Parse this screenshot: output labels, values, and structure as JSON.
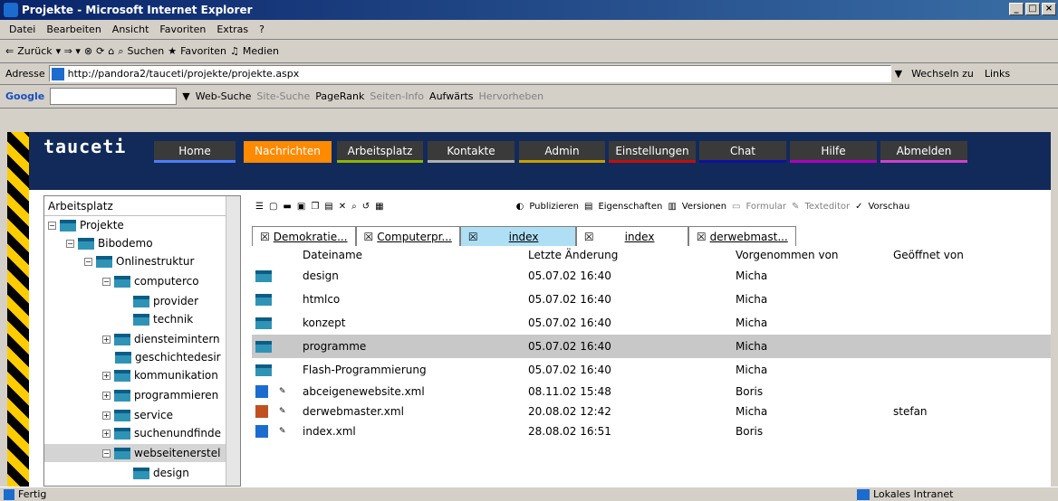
{
  "window": {
    "title": "Projekte - Microsoft Internet Explorer"
  },
  "menu": [
    "Datei",
    "Bearbeiten",
    "Ansicht",
    "Favoriten",
    "Extras",
    "?"
  ],
  "toolbar": {
    "back": "Zurück",
    "search": "Suchen",
    "favorites": "Favoriten",
    "media": "Medien"
  },
  "address": {
    "label": "Adresse",
    "url": "http://pandora2/tauceti/projekte/projekte.aspx",
    "go": "Wechseln zu",
    "links": "Links"
  },
  "google": {
    "label": "Google",
    "web_search": "Web-Suche",
    "site_search": "Site-Suche",
    "pagerank": "PageRank",
    "page_info": "Seiten-Info",
    "up": "Aufwärts",
    "highlight": "Hervorheben"
  },
  "app": {
    "logo": "tauceti",
    "nav": [
      {
        "label": "Home",
        "color": "#4d7cff"
      },
      {
        "label": "Nachrichten",
        "color": "#ff8a00"
      },
      {
        "label": "Arbeitsplatz",
        "color": "#8db600"
      },
      {
        "label": "Kontakte",
        "color": "#b0b0b0"
      },
      {
        "label": "Admin",
        "color": "#c8a000"
      },
      {
        "label": "Einstellungen",
        "color": "#c01010"
      },
      {
        "label": "Chat",
        "color": "#1010a0"
      },
      {
        "label": "Hilfe",
        "color": "#b000c0"
      },
      {
        "label": "Abmelden",
        "color": "#d040d0"
      }
    ]
  },
  "sidebar": {
    "title": "Arbeitsplatz",
    "items": [
      {
        "label": "Projekte",
        "expander": "−"
      },
      {
        "label": "Bibodemo",
        "expander": "−"
      },
      {
        "label": "Onlinestruktur",
        "expander": "−"
      },
      {
        "label": "computerco",
        "expander": "−"
      },
      {
        "label": "provider",
        "expander": ""
      },
      {
        "label": "technik",
        "expander": ""
      },
      {
        "label": "diensteimintern",
        "expander": "+"
      },
      {
        "label": "geschichtedesir",
        "expander": ""
      },
      {
        "label": "kommunikation",
        "expander": "+"
      },
      {
        "label": "programmieren",
        "expander": "+"
      },
      {
        "label": "service",
        "expander": "+"
      },
      {
        "label": "suchenundfinde",
        "expander": "+"
      },
      {
        "label": "webseitenerstel",
        "expander": "−"
      },
      {
        "label": "design",
        "expander": ""
      }
    ]
  },
  "main": {
    "toolbar": {
      "publish": "Publizieren",
      "properties": "Eigenschaften",
      "versions": "Versionen",
      "form": "Formular",
      "texteditor": "Texteditor",
      "preview": "Vorschau"
    },
    "tabs": [
      "Demokratie...",
      "Computerpr...",
      "index",
      "index",
      "derwebmast..."
    ],
    "columns": [
      "Dateiname",
      "Letzte Änderung",
      "Vorgenommen von",
      "Geöffnet von"
    ],
    "rows": [
      {
        "name": "design",
        "date": "05.07.02 16:40",
        "by": "Micha",
        "open": "",
        "type": "folder"
      },
      {
        "name": "htmlco",
        "date": "05.07.02 16:40",
        "by": "Micha",
        "open": "",
        "type": "folder"
      },
      {
        "name": "konzept",
        "date": "05.07.02 16:40",
        "by": "Micha",
        "open": "",
        "type": "folder"
      },
      {
        "name": "programme",
        "date": "05.07.02 16:40",
        "by": "Micha",
        "open": "",
        "type": "folder"
      },
      {
        "name": "Flash-Programmierung",
        "date": "05.07.02 16:40",
        "by": "Micha",
        "open": "",
        "type": "folder"
      },
      {
        "name": "abceigenewebsite.xml",
        "date": "08.11.02 15:48",
        "by": "Boris",
        "open": "",
        "type": "xml"
      },
      {
        "name": "derwebmaster.xml",
        "date": "20.08.02 12:42",
        "by": "Micha",
        "open": "stefan",
        "type": "xml"
      },
      {
        "name": "index.xml",
        "date": "28.08.02 16:51",
        "by": "Boris",
        "open": "",
        "type": "xml"
      }
    ]
  },
  "status": {
    "left": "Fertig",
    "zone": "Lokales Intranet"
  }
}
